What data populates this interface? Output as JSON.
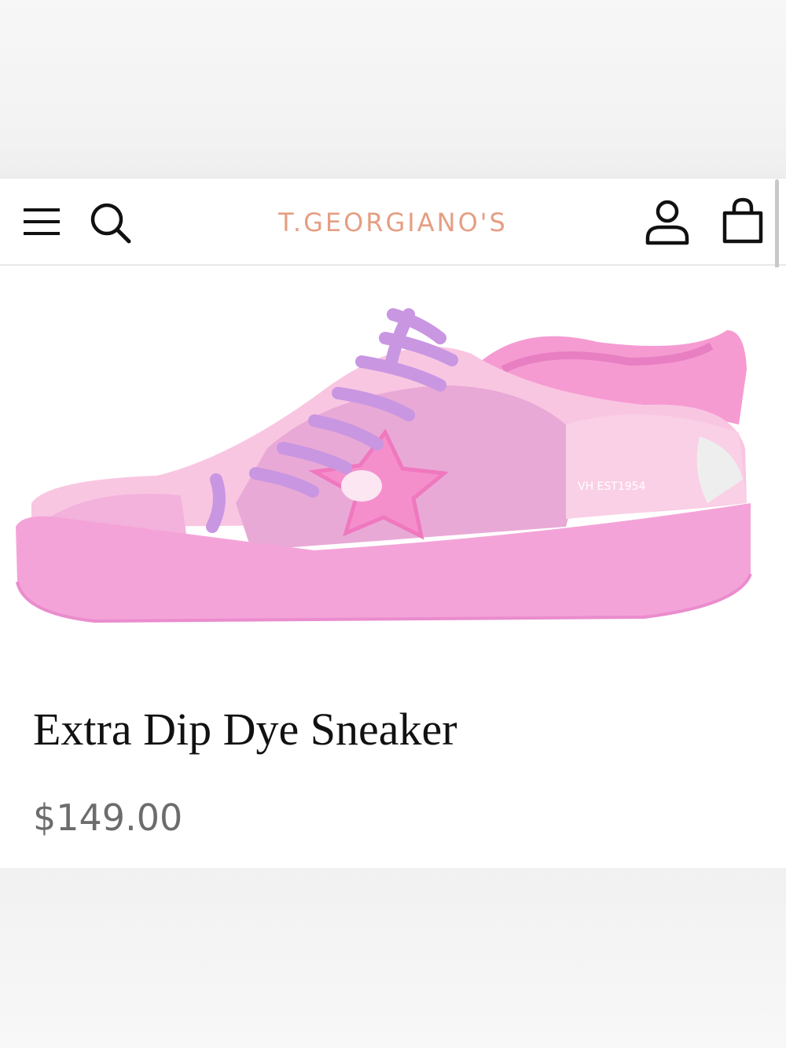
{
  "header": {
    "brand": "T.GEORGIANO'S",
    "menu_icon": "hamburger-menu-icon",
    "search_icon": "search-icon",
    "account_icon": "account-icon",
    "bag_icon": "shopping-bag-icon"
  },
  "product": {
    "title": "Extra Dip Dye Sneaker",
    "price": "$149.00",
    "image_text": "VH EST1954"
  },
  "colors": {
    "brand": "#e59e83",
    "sneaker_body": "#f5a9d8",
    "sneaker_panel": "#f9c4e1",
    "laces": "#c99be3"
  }
}
